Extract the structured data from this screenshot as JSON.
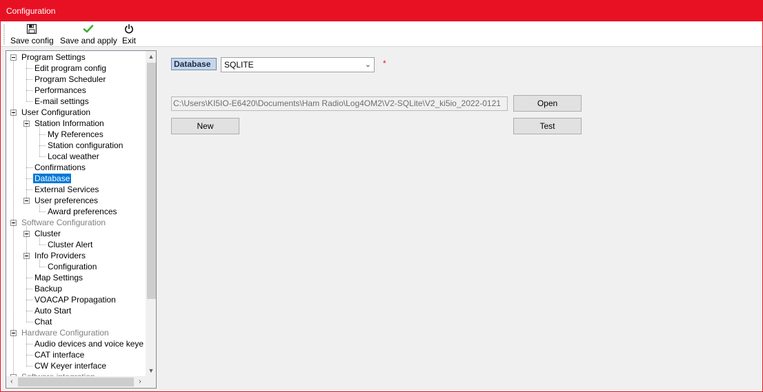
{
  "window": {
    "title": "Configuration"
  },
  "toolbar": {
    "buttons": [
      {
        "label": "Save config",
        "icon": "floppy-disk-icon"
      },
      {
        "label": "Save and apply",
        "icon": "green-checkmark-icon"
      },
      {
        "label": "Exit",
        "icon": "power-icon"
      }
    ]
  },
  "tree": {
    "nodes": [
      {
        "label": "Program Settings",
        "level": 0,
        "expander": true
      },
      {
        "label": "Edit program config",
        "level": 1
      },
      {
        "label": "Program Scheduler",
        "level": 1
      },
      {
        "label": "Performances",
        "level": 1
      },
      {
        "label": "E-mail settings",
        "level": 1
      },
      {
        "label": "User Configuration",
        "level": 0,
        "expander": true
      },
      {
        "label": "Station Information",
        "level": 1,
        "expander": true
      },
      {
        "label": "My References",
        "level": 2
      },
      {
        "label": "Station configuration",
        "level": 2
      },
      {
        "label": "Local weather",
        "level": 2
      },
      {
        "label": "Confirmations",
        "level": 1
      },
      {
        "label": "Database",
        "level": 1,
        "selected": true
      },
      {
        "label": "External Services",
        "level": 1
      },
      {
        "label": "User preferences",
        "level": 1,
        "expander": true
      },
      {
        "label": "Award preferences",
        "level": 2
      },
      {
        "label": "Software Configuration",
        "level": 0,
        "expander": true,
        "disabled": true
      },
      {
        "label": "Cluster",
        "level": 1,
        "expander": true
      },
      {
        "label": "Cluster Alert",
        "level": 2
      },
      {
        "label": "Info Providers",
        "level": 1,
        "expander": true
      },
      {
        "label": "Configuration",
        "level": 2
      },
      {
        "label": "Map Settings",
        "level": 1
      },
      {
        "label": "Backup",
        "level": 1
      },
      {
        "label": "VOACAP Propagation",
        "level": 1
      },
      {
        "label": "Auto Start",
        "level": 1
      },
      {
        "label": "Chat",
        "level": 1
      },
      {
        "label": "Hardware Configuration",
        "level": 0,
        "expander": true,
        "disabled": true
      },
      {
        "label": "Audio devices and voice keye",
        "level": 1
      },
      {
        "label": "CAT interface",
        "level": 1
      },
      {
        "label": "CW Keyer interface",
        "level": 1
      },
      {
        "label": "Software integration",
        "level": 0,
        "expander": true,
        "disabled": true
      }
    ]
  },
  "database": {
    "label": "Database",
    "selected_type": "SQLITE",
    "required_marker": "*",
    "path_value": "C:\\Users\\KI5IO-E6420\\Documents\\Ham Radio\\Log4OM2\\V2-SQLite\\V2_ki5io_2022-0121",
    "open_label": "Open",
    "new_label": "New",
    "test_label": "Test"
  },
  "colors": {
    "titlebar": "#e81123",
    "selection": "#0078d7",
    "database_label_bg": "#c5d6ea"
  }
}
